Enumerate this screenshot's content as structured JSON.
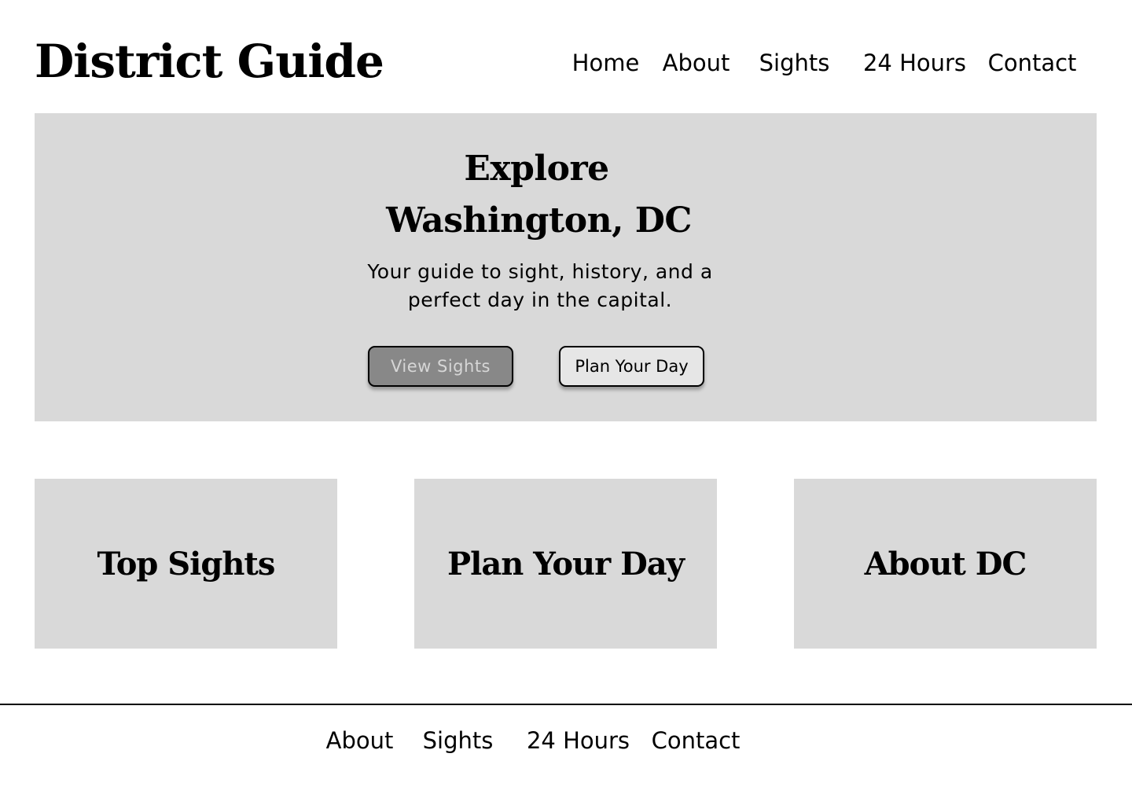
{
  "header": {
    "site_title": "District Guide",
    "nav": [
      "Home",
      "About",
      "Sights",
      "24 Hours",
      "Contact"
    ]
  },
  "hero": {
    "title_line1": "Explore",
    "title_line2": "Washington, DC",
    "subtitle": "Your guide to sight, history, and a perfect day in the capital.",
    "primary_button": "View Sights",
    "secondary_button": "Plan Your Day"
  },
  "cards": [
    "Top Sights",
    "Plan Your Day",
    "About DC"
  ],
  "footer": {
    "nav": [
      "About",
      "Sights",
      "24 Hours",
      "Contact"
    ]
  },
  "colors": {
    "page_background": "#ffffff",
    "panel_gray": "#d9d9d9",
    "primary_button_fill": "#888888",
    "primary_button_text": "#d6d6d6",
    "secondary_button_fill": "#e6e6e6",
    "text": "#000000"
  }
}
